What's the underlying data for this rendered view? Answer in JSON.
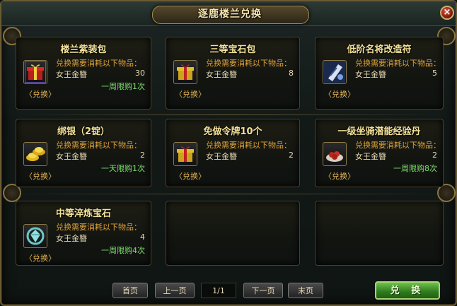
{
  "window": {
    "title": "逐鹿楼兰兑换",
    "close_label": "×"
  },
  "common": {
    "requirement_text": "兑换需要消耗以下物品：",
    "exchange_link": "〈兑换〉"
  },
  "items": [
    {
      "title": "楼兰紫装包",
      "material": "女王金簪",
      "qty": "30",
      "limit": "一周限购1次",
      "icon": "gift-box-icon"
    },
    {
      "title": "三等宝石包",
      "material": "女王金簪",
      "qty": "8",
      "limit": "",
      "icon": "gift-box-icon"
    },
    {
      "title": "低阶名将改造符",
      "material": "女王金簪",
      "qty": "5",
      "limit": "",
      "icon": "talisman-scroll-icon"
    },
    {
      "title": "绑银（2锭）",
      "material": "女王金簪",
      "qty": "2",
      "limit": "一天限购1次",
      "icon": "silver-ingot-icon"
    },
    {
      "title": "免做令牌10个",
      "material": "女王金簪",
      "qty": "2",
      "limit": "",
      "icon": "gift-box-icon"
    },
    {
      "title": "一级坐骑潜能经验丹",
      "material": "女王金簪",
      "qty": "2",
      "limit": "一周限购8次",
      "icon": "pill-plate-icon"
    },
    {
      "title": "中等淬炼宝石",
      "material": "女王金簪",
      "qty": "4",
      "limit": "一周限购4次",
      "icon": "gem-icon"
    }
  ],
  "pager": {
    "first": "首页",
    "prev": "上一页",
    "indicator": "1/1",
    "next": "下一页",
    "last": "末页"
  },
  "exchange_button": "兑 换"
}
